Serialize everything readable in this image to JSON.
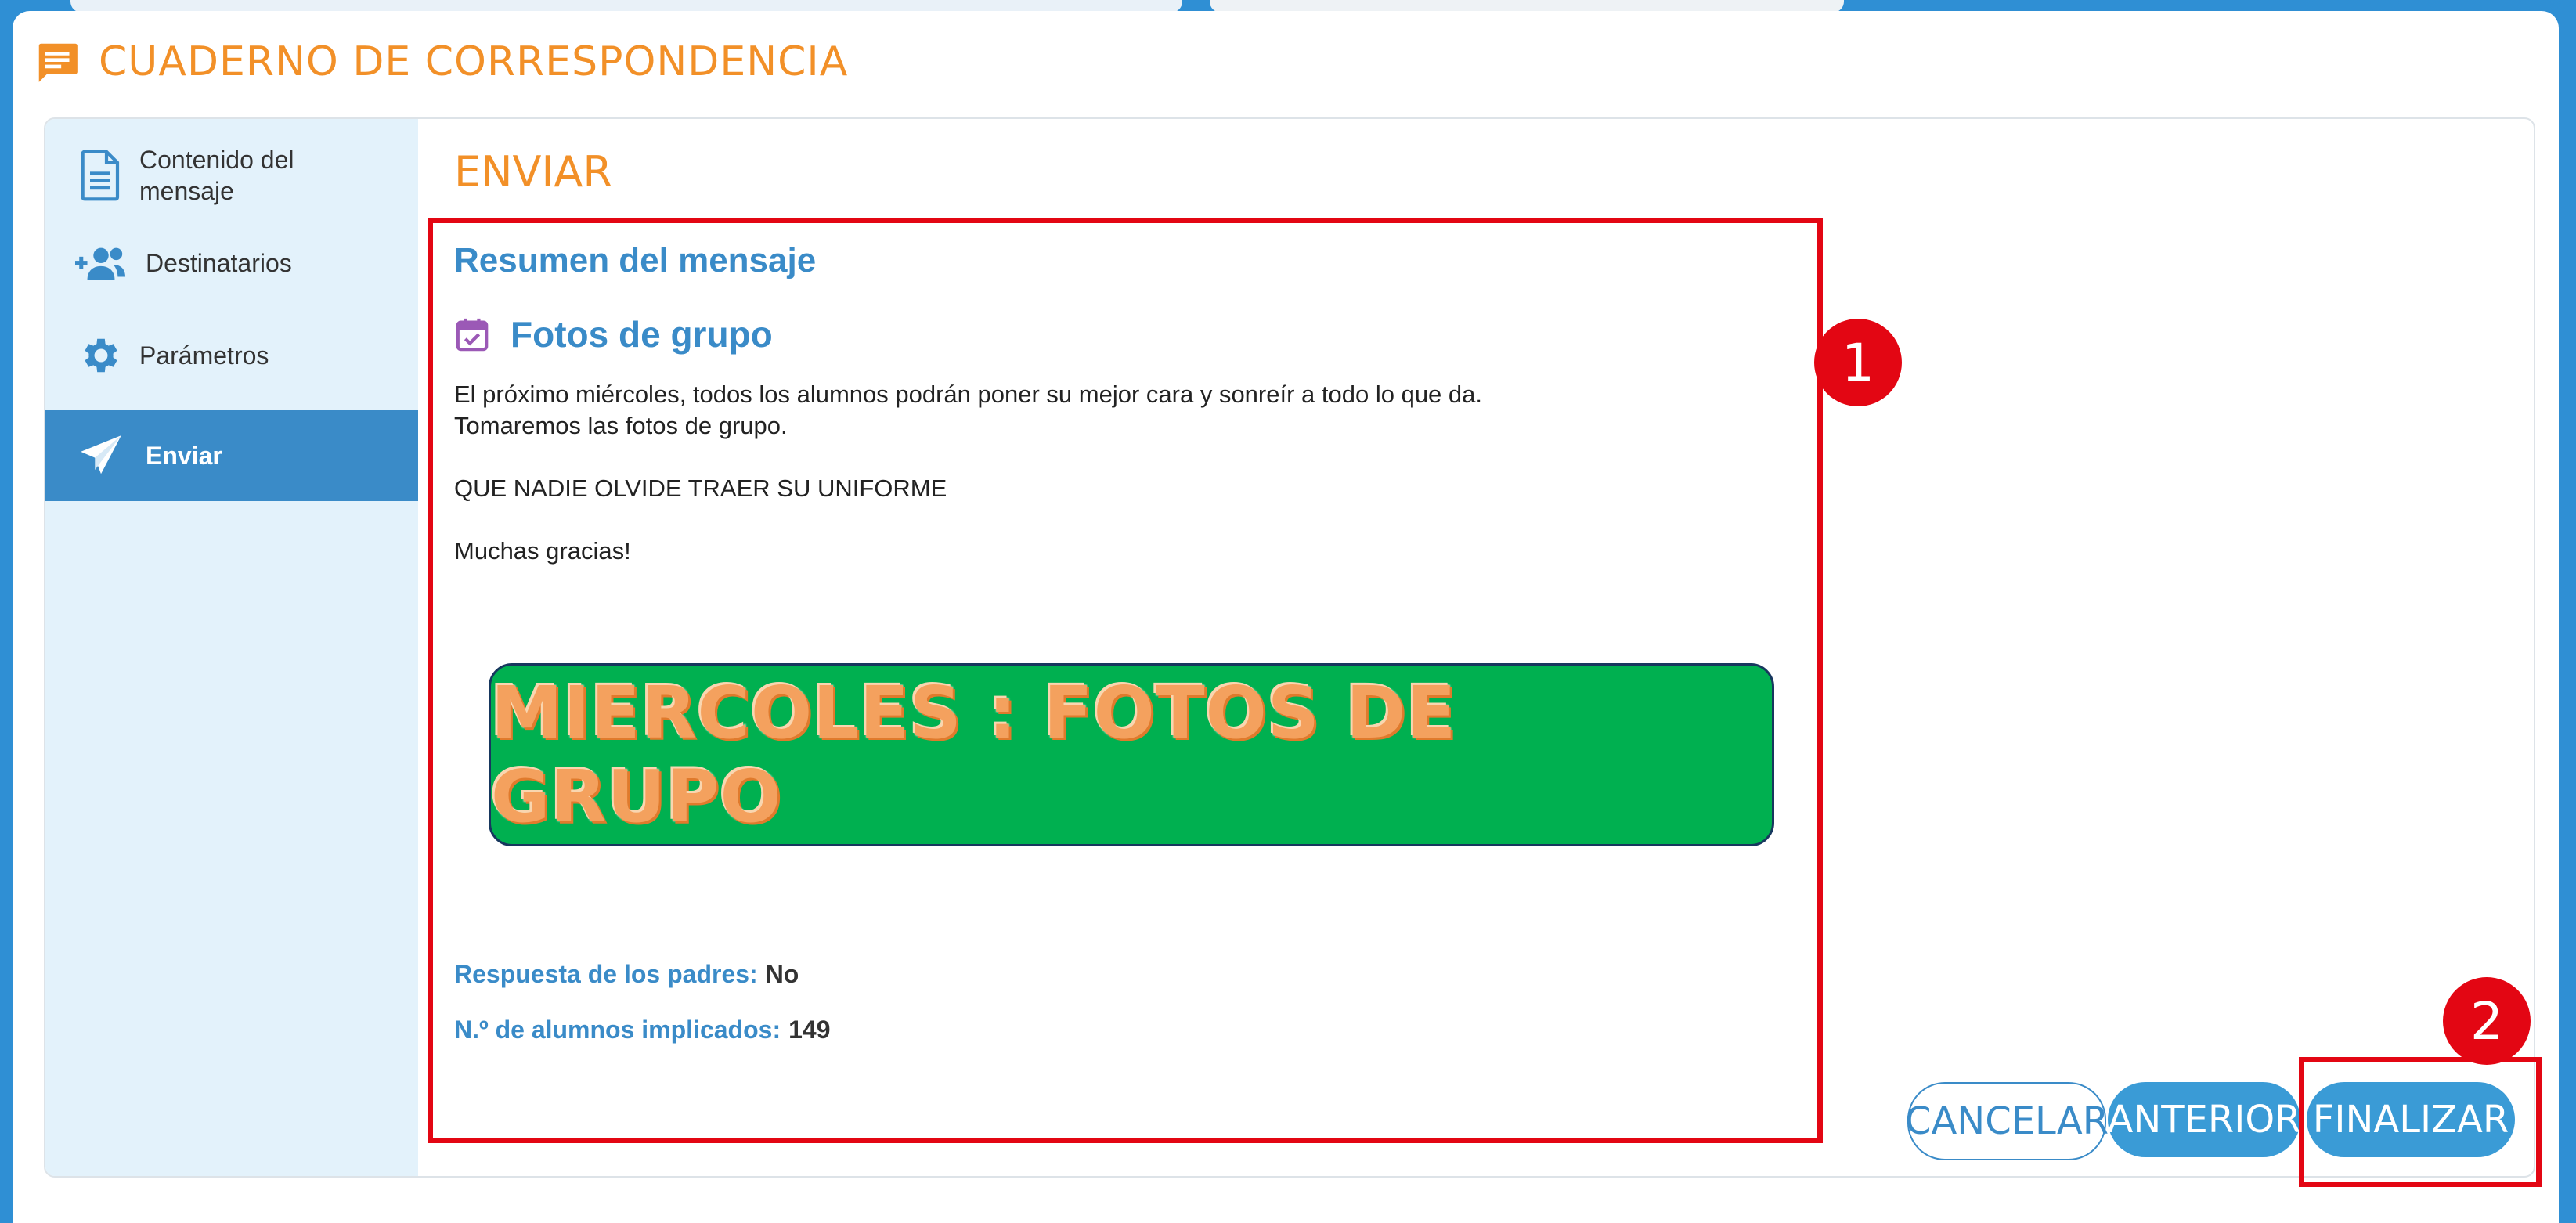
{
  "app": {
    "title": "CUADERNO DE CORRESPONDENCIA",
    "icon": "message-note-icon",
    "accent_color": "#f29028"
  },
  "sidebar": {
    "items": [
      {
        "label": "Contenido del mensaje",
        "icon": "document-icon",
        "active": false
      },
      {
        "label": "Destinatarios",
        "icon": "add-users-icon",
        "active": false
      },
      {
        "label": "Parámetros",
        "icon": "gear-icon",
        "active": false
      },
      {
        "label": "Enviar",
        "icon": "paper-plane-icon",
        "active": true
      }
    ]
  },
  "content": {
    "title": "ENVIAR",
    "summary_heading": "Resumen del mensaje",
    "event_icon": "calendar-check-icon",
    "event_title": "Fotos de grupo",
    "body_lines": [
      "El próximo miércoles, todos los alumnos podrán poner su mejor cara y sonreír a todo lo que da.",
      "Tomaremos las fotos de grupo.",
      "",
      "QUE NADIE OLVIDE TRAER SU UNIFORME",
      "",
      "Muchas gracias!"
    ],
    "banner_text": "MIERCOLES : FOTOS DE GRUPO",
    "parent_reply_label": "Respuesta de los padres:",
    "parent_reply_value": "No",
    "students_label": "N.º de alumnos implicados:",
    "students_value": "149"
  },
  "buttons": {
    "cancel": "CANCELAR",
    "previous": "ANTERIOR",
    "finish": "FINALIZAR"
  },
  "annotations": {
    "badge_1": "1",
    "badge_2": "2",
    "highlight_color": "#e30613"
  }
}
